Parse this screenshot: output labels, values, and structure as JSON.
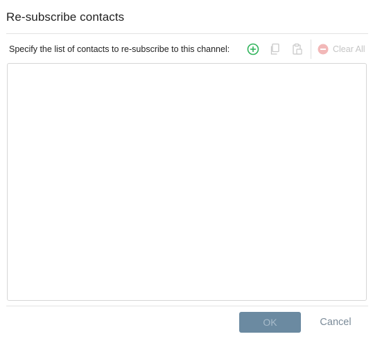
{
  "dialog": {
    "title": "Re-subscribe contacts",
    "instructions": "Specify the list of contacts to re-subscribe to this channel:",
    "toolbar": {
      "add_icon": "plus-circle-icon",
      "copy_icon": "copy-icon",
      "paste_icon": "paste-icon",
      "clear_icon": "minus-circle-icon",
      "clear_all_label": "Clear All"
    },
    "contacts": [],
    "ok_label": "OK",
    "cancel_label": "Cancel"
  },
  "colors": {
    "add": "#2fb35a",
    "disabled": "#c8c8c8",
    "clear": "#f2b8b8",
    "ok_bg": "#6b8aa1",
    "cancel_text": "#7a8a98"
  }
}
